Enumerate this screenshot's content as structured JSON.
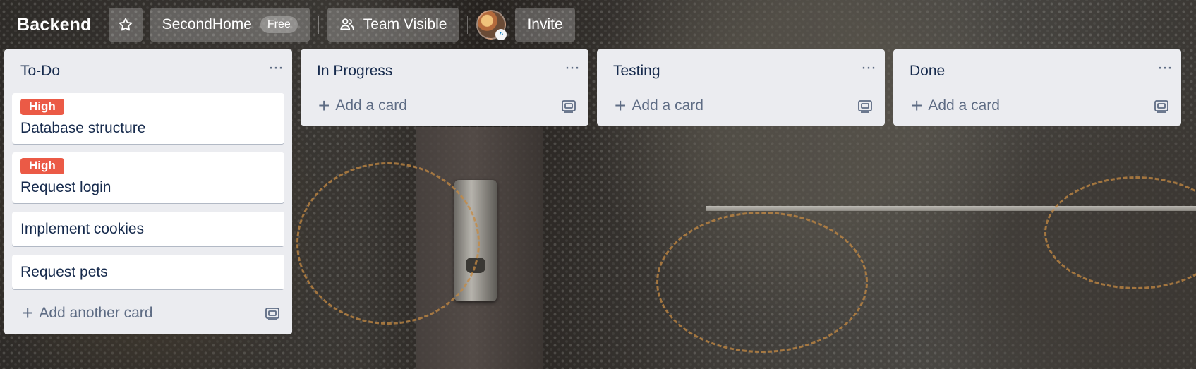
{
  "header": {
    "board_title": "Backend",
    "star_icon": "star-icon",
    "workspace_name": "SecondHome",
    "workspace_plan": "Free",
    "visibility_label": "Team Visible",
    "invite_label": "Invite"
  },
  "lists": [
    {
      "title": "To-Do",
      "cards": [
        {
          "label": "High",
          "title": "Database structure"
        },
        {
          "label": "High",
          "title": "Request login"
        },
        {
          "title": "Implement cookies"
        },
        {
          "title": "Request pets"
        }
      ],
      "add_label": "Add another card"
    },
    {
      "title": "In Progress",
      "cards": [],
      "add_label": "Add a card"
    },
    {
      "title": "Testing",
      "cards": [],
      "add_label": "Add a card"
    },
    {
      "title": "Done",
      "cards": [],
      "add_label": "Add a card"
    }
  ],
  "list_menu_glyph": "···",
  "add_glyph": "+",
  "colors": {
    "label_high": "#eb5a46",
    "list_bg": "#ebecf0",
    "card_text": "#172b4d"
  }
}
